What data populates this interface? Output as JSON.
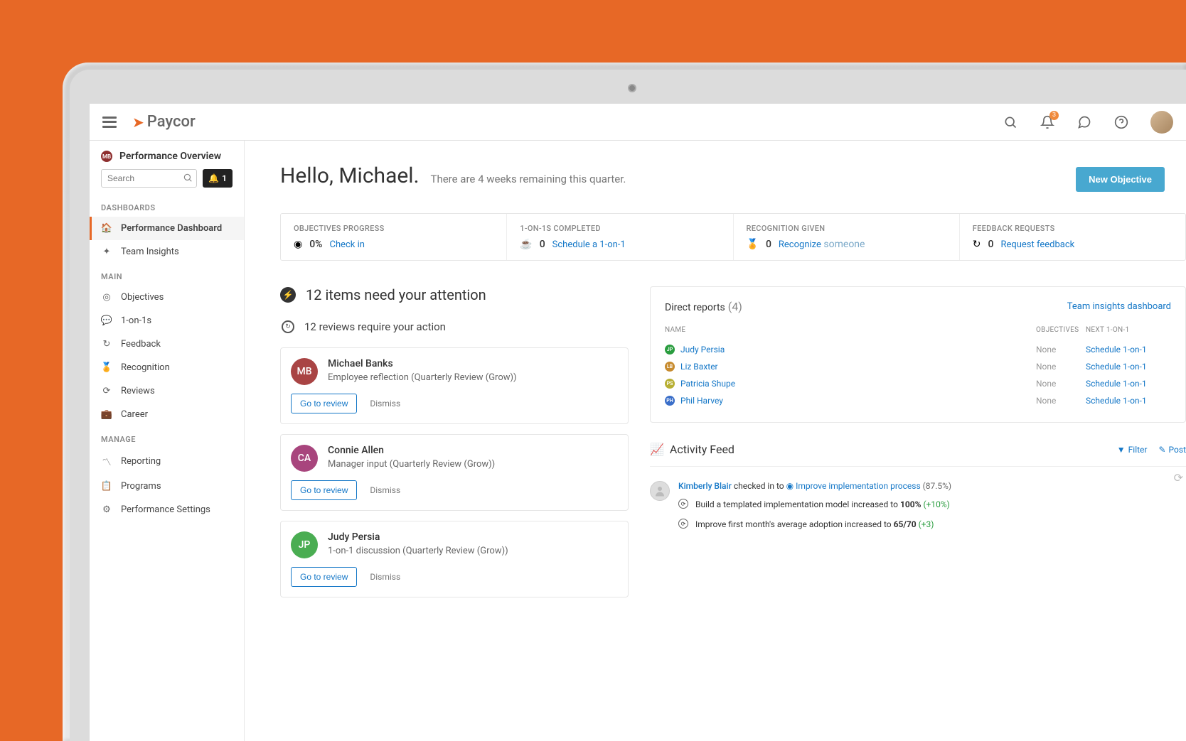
{
  "brand": "Paycor",
  "topbar": {
    "bell_count": "3"
  },
  "sidebar": {
    "badge": "MB",
    "title": "Performance Overview",
    "search_placeholder": "Search",
    "notif_count": "1",
    "sections": {
      "dashboards_label": "DASHBOARDS",
      "main_label": "MAIN",
      "manage_label": "MANAGE"
    },
    "items": {
      "perf_dashboard": "Performance Dashboard",
      "team_insights": "Team Insights",
      "objectives": "Objectives",
      "one_on_ones": "1-on-1s",
      "feedback": "Feedback",
      "recognition": "Recognition",
      "reviews": "Reviews",
      "career": "Career",
      "reporting": "Reporting",
      "programs": "Programs",
      "perf_settings": "Performance Settings"
    }
  },
  "hero": {
    "greeting": "Hello, Michael.",
    "subtitle": "There are 4 weeks remaining this quarter.",
    "new_objective_label": "New Objective"
  },
  "stats": {
    "objectives": {
      "label": "OBJECTIVES PROGRESS",
      "value": "0%",
      "link": "Check in"
    },
    "oneonones": {
      "label": "1-ON-1S COMPLETED",
      "value": "0",
      "link": "Schedule a 1-on-1"
    },
    "recognition": {
      "label": "RECOGNITION GIVEN",
      "value": "0",
      "link_pre": "Recognize",
      "link_suf": "someone"
    },
    "feedback": {
      "label": "FEEDBACK REQUESTS",
      "value": "0",
      "link": "Request feedback"
    }
  },
  "attention": {
    "title": "12 items need your attention",
    "subtitle": "12 reviews require your action",
    "go_to_review": "Go to review",
    "dismiss": "Dismiss",
    "cards": [
      {
        "initials": "MB",
        "color": "#a94444",
        "name": "Michael Banks",
        "desc": "Employee reflection (Quarterly Review (Grow))"
      },
      {
        "initials": "CA",
        "color": "#a8457d",
        "name": "Connie Allen",
        "desc": "Manager input (Quarterly Review (Grow))"
      },
      {
        "initials": "JP",
        "color": "#4aad52",
        "name": "Judy Persia",
        "desc": "1-on-1 discussion (Quarterly Review (Grow))"
      }
    ]
  },
  "reports": {
    "title": "Direct reports",
    "count": "(4)",
    "dashboard_link": "Team insights dashboard",
    "col_name": "NAME",
    "col_obj": "OBJECTIVES",
    "col_next": "NEXT 1-ON-1",
    "none_label": "None",
    "schedule_label": "Schedule 1-on-1",
    "rows": [
      {
        "dotcolor": "#2a9d3f",
        "dot": "JP",
        "name": "Judy Persia"
      },
      {
        "dotcolor": "#c78b2f",
        "dot": "LB",
        "name": "Liz Baxter"
      },
      {
        "dotcolor": "#b8b034",
        "dot": "PS",
        "name": "Patricia Shupe"
      },
      {
        "dotcolor": "#3b6fc9",
        "dot": "PH",
        "name": "Phil Harvey"
      }
    ]
  },
  "feed": {
    "title": "Activity Feed",
    "filter_label": "Filter",
    "post_label": "Post",
    "item": {
      "user": "Kimberly Blair",
      "action": "checked in to",
      "objective": "Improve implementation process",
      "percent": "(87.5%)",
      "sub1_text": "Build a templated implementation model increased to",
      "sub1_val": "100%",
      "sub1_delta": "(+10%)",
      "sub2_text": "Improve first month's average adoption increased to",
      "sub2_val": "65/70",
      "sub2_delta": "(+3)"
    }
  }
}
